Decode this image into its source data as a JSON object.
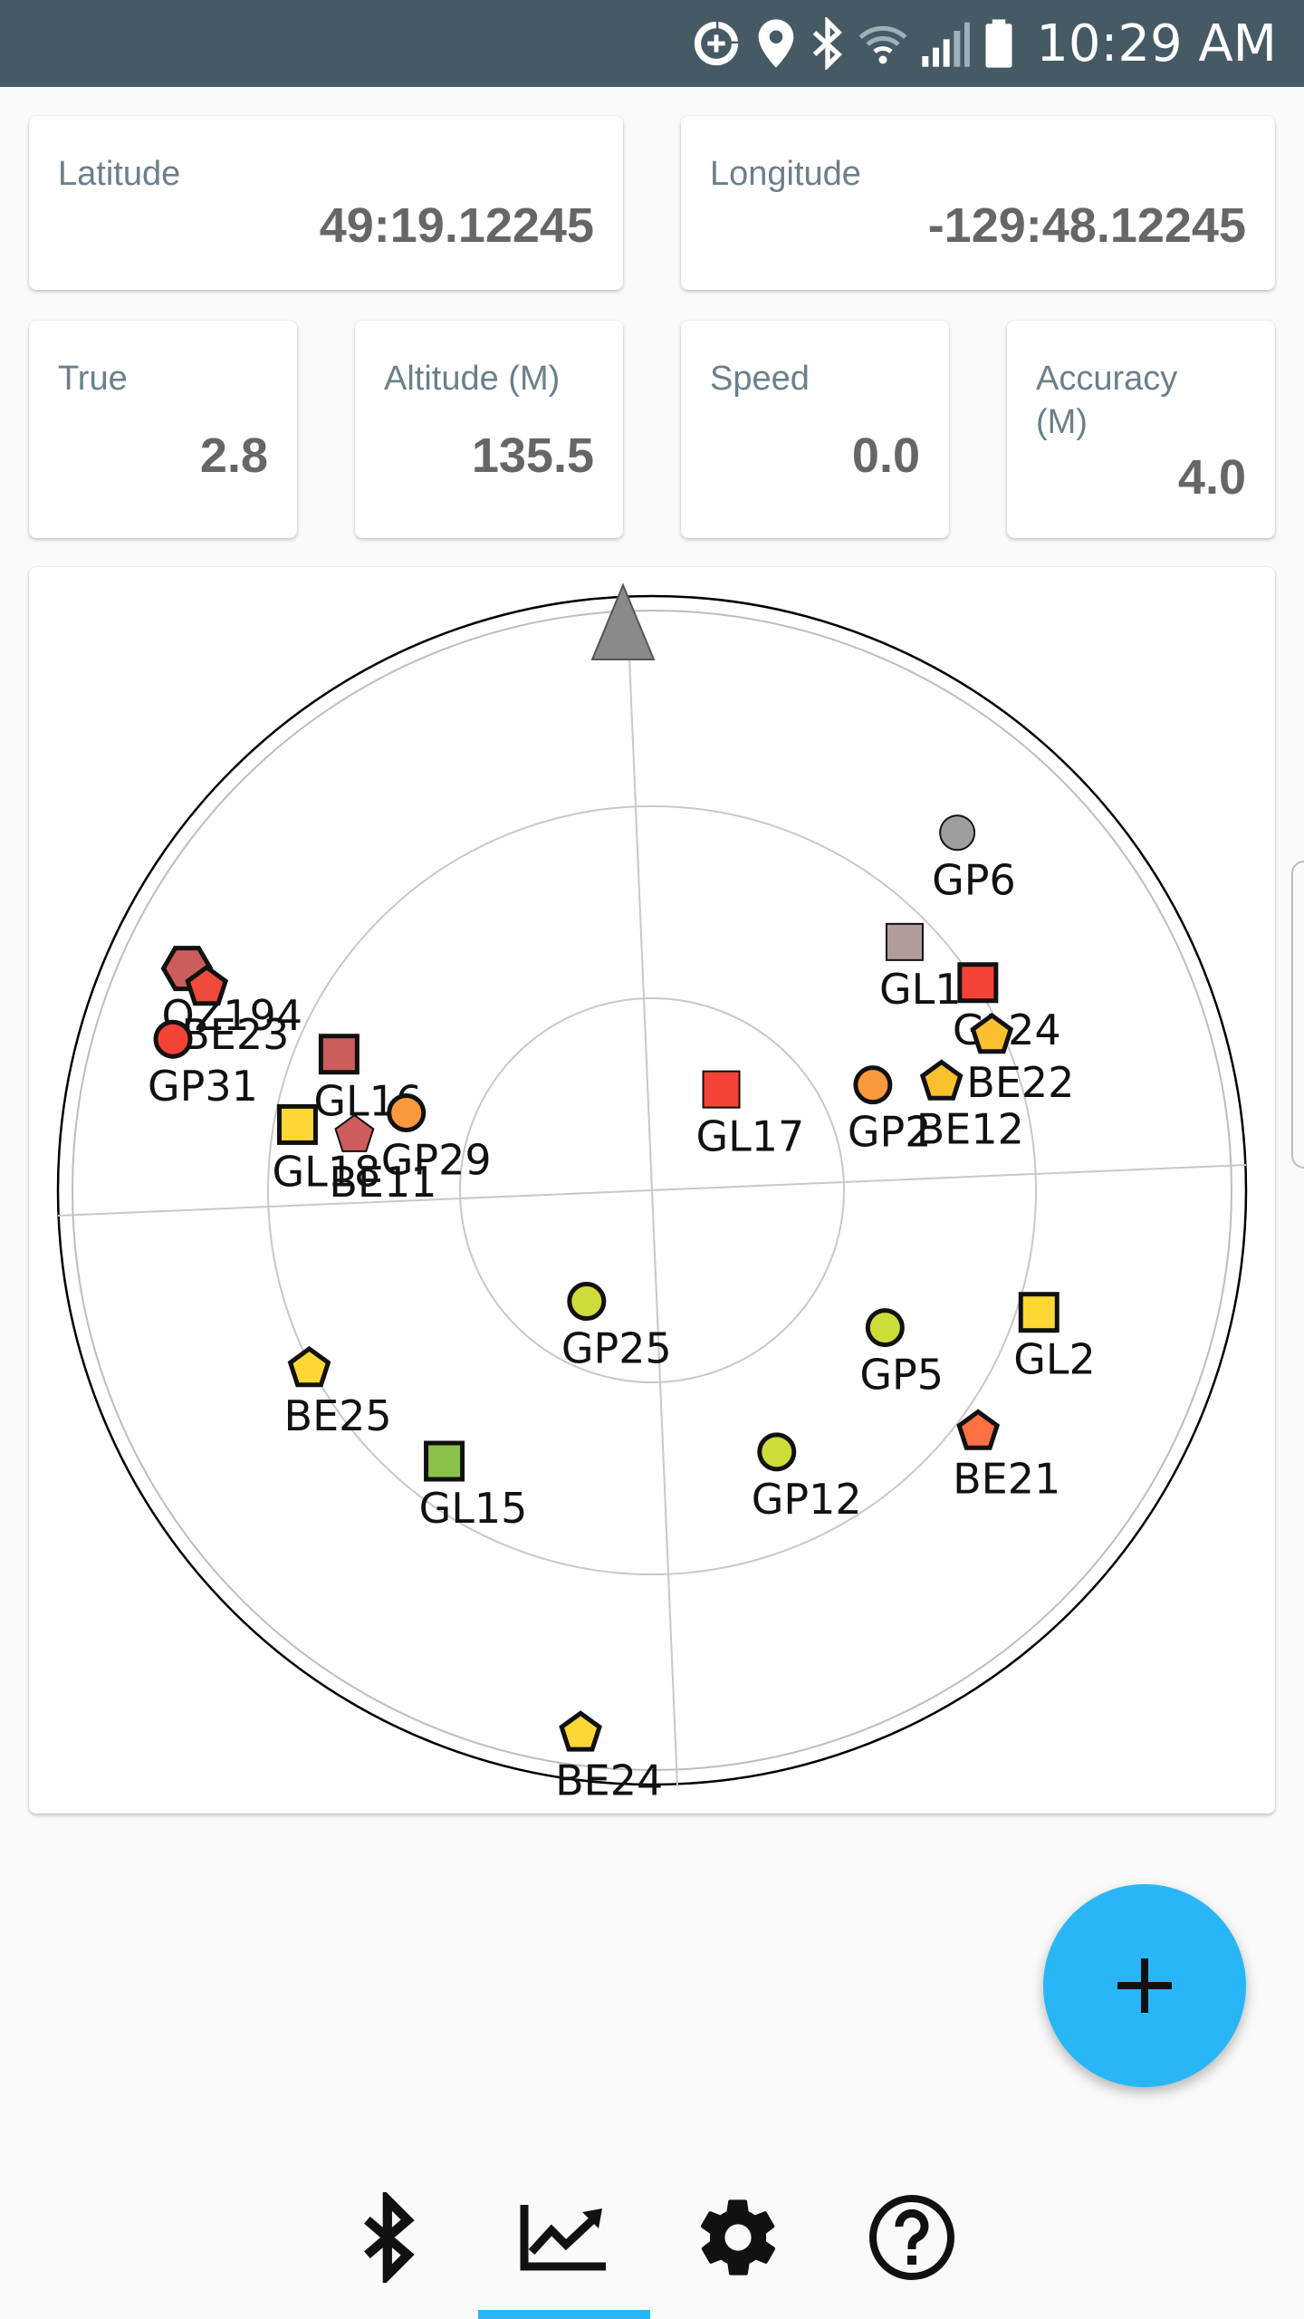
{
  "status_bar": {
    "time": "10:29 AM",
    "icons": [
      "data-saver-icon",
      "location-icon",
      "bluetooth-icon",
      "wifi-icon",
      "signal-icon",
      "battery-icon"
    ],
    "background": "#455a64"
  },
  "position": {
    "latitude": {
      "label": "Latitude",
      "value": "49:19.12245"
    },
    "longitude": {
      "label": "Longitude",
      "value": "-129:48.12245"
    }
  },
  "metrics": [
    {
      "label": "True",
      "value": "2.8"
    },
    {
      "label": "Altitude (M)",
      "value": "135.5"
    },
    {
      "label": "Speed",
      "value": "0.0"
    },
    {
      "label": "Accuracy (M)",
      "value": "4.0"
    }
  ],
  "skyplot": {
    "north_marker_icon": "north-arrow-icon",
    "satellites": [
      {
        "id": "GP6",
        "shape": "circle",
        "color": "#9e9e9e",
        "azimuth": 43,
        "elevation": 17,
        "bold": false
      },
      {
        "id": "GL1",
        "shape": "square",
        "color": "#b39c9c",
        "azimuth": 48,
        "elevation": 35,
        "bold": false
      },
      {
        "id": "GL24",
        "shape": "square",
        "color": "#f44336",
        "azimuth": 60,
        "elevation": 30,
        "bold": true
      },
      {
        "id": "GL17",
        "shape": "square",
        "color": "#f44336",
        "azimuth": 37,
        "elevation": 71,
        "bold": false
      },
      {
        "id": "GP2",
        "shape": "circle",
        "color": "#fb9a3c",
        "azimuth": 67,
        "elevation": 52,
        "bold": true
      },
      {
        "id": "BE22",
        "shape": "pentagon",
        "color": "#fbc02d",
        "azimuth": 68,
        "elevation": 32,
        "bold": true
      },
      {
        "id": "BE12",
        "shape": "pentagon",
        "color": "#fbc02d",
        "azimuth": 72,
        "elevation": 42,
        "bold": true
      },
      {
        "id": "QZ194",
        "shape": "hexagon",
        "color": "#cd5c5c",
        "azimuth": 298,
        "elevation": 10,
        "bold": true
      },
      {
        "id": "BE23",
        "shape": "pentagon",
        "color": "#ef4b3c",
        "azimuth": 297,
        "elevation": 14,
        "bold": true
      },
      {
        "id": "GP31",
        "shape": "circle",
        "color": "#f44336",
        "azimuth": 290,
        "elevation": 12,
        "bold": true
      },
      {
        "id": "GL16",
        "shape": "square",
        "color": "#cd5c5c",
        "azimuth": 296,
        "elevation": 37,
        "bold": true
      },
      {
        "id": "GP29",
        "shape": "circle",
        "color": "#fb9a3c",
        "azimuth": 290,
        "elevation": 50,
        "bold": true
      },
      {
        "id": "GL18",
        "shape": "square",
        "color": "#fdd835",
        "azimuth": 283,
        "elevation": 34,
        "bold": true
      },
      {
        "id": "BE11",
        "shape": "pentagon",
        "color": "#cd5c5c",
        "azimuth": 283,
        "elevation": 43,
        "bold": false
      },
      {
        "id": "GP25",
        "shape": "circle",
        "color": "#cddc39",
        "azimuth": 213,
        "elevation": 70,
        "bold": true
      },
      {
        "id": "BE25",
        "shape": "pentagon",
        "color": "#fdd835",
        "azimuth": 245,
        "elevation": 30,
        "bold": true
      },
      {
        "id": "GL15",
        "shape": "square",
        "color": "#8bc34a",
        "azimuth": 220,
        "elevation": 37,
        "bold": true
      },
      {
        "id": "GP5",
        "shape": "circle",
        "color": "#cddc39",
        "azimuth": 123,
        "elevation": 48,
        "bold": true
      },
      {
        "id": "GL2",
        "shape": "square",
        "color": "#fdd835",
        "azimuth": 110,
        "elevation": 27,
        "bold": true
      },
      {
        "id": "BE21",
        "shape": "pentagon",
        "color": "#ff7043",
        "azimuth": 129,
        "elevation": 27,
        "bold": true
      },
      {
        "id": "GP12",
        "shape": "circle",
        "color": "#cddc39",
        "azimuth": 157,
        "elevation": 45,
        "bold": true
      },
      {
        "id": "BE24",
        "shape": "pentagon",
        "color": "#fdd835",
        "azimuth": 190,
        "elevation": 5,
        "bold": true
      }
    ]
  },
  "fab": {
    "icon": "plus-icon",
    "color": "#29b6f6"
  },
  "bottom_nav": {
    "items": [
      {
        "name": "bluetooth",
        "icon": "bluetooth-icon"
      },
      {
        "name": "status",
        "icon": "chart-trend-icon",
        "selected": true
      },
      {
        "name": "settings",
        "icon": "gear-icon"
      },
      {
        "name": "help",
        "icon": "help-circle-icon"
      }
    ],
    "accent": "#29b6f6"
  }
}
